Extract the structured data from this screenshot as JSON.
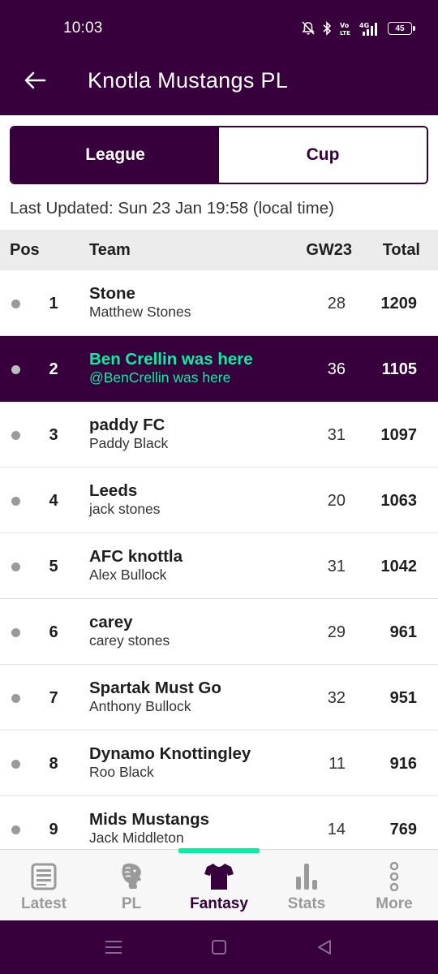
{
  "status_bar": {
    "time": "10:03",
    "battery": "45"
  },
  "header": {
    "title": "Knotla Mustangs PL",
    "back_icon": "arrow-left-icon"
  },
  "tabs": [
    {
      "label": "League",
      "active": true
    },
    {
      "label": "Cup",
      "active": false
    }
  ],
  "last_updated": "Last Updated: Sun 23 Jan 19:58 (local time)",
  "table": {
    "headers": {
      "pos": "Pos",
      "team": "Team",
      "gw": "GW23",
      "total": "Total"
    },
    "rows": [
      {
        "pos": "1",
        "team": "Stone",
        "manager": "Matthew Stones",
        "gw": "28",
        "total": "1209",
        "highlight": false
      },
      {
        "pos": "2",
        "team": "Ben Crellin was here",
        "manager": "@BenCrellin was here",
        "gw": "36",
        "total": "1105",
        "highlight": true
      },
      {
        "pos": "3",
        "team": "paddy FC",
        "manager": "Paddy Black",
        "gw": "31",
        "total": "1097",
        "highlight": false
      },
      {
        "pos": "4",
        "team": "Leeds",
        "manager": "jack stones",
        "gw": "20",
        "total": "1063",
        "highlight": false
      },
      {
        "pos": "5",
        "team": "AFC knottla",
        "manager": "Alex Bullock",
        "gw": "31",
        "total": "1042",
        "highlight": false
      },
      {
        "pos": "6",
        "team": "carey",
        "manager": "carey stones",
        "gw": "29",
        "total": "961",
        "highlight": false
      },
      {
        "pos": "7",
        "team": "Spartak Must Go",
        "manager": "Anthony Bullock",
        "gw": "32",
        "total": "951",
        "highlight": false
      },
      {
        "pos": "8",
        "team": "Dynamo Knottingley",
        "manager": "Roo Black",
        "gw": "11",
        "total": "916",
        "highlight": false
      },
      {
        "pos": "9",
        "team": "Mids Mustangs",
        "manager": "Jack Middleton",
        "gw": "14",
        "total": "769",
        "highlight": false
      }
    ]
  },
  "bottom_nav": [
    {
      "label": "Latest",
      "icon": "news-icon",
      "active": false
    },
    {
      "label": "PL",
      "icon": "lion-icon",
      "active": false
    },
    {
      "label": "Fantasy",
      "icon": "shirt-icon",
      "active": true
    },
    {
      "label": "Stats",
      "icon": "bar-chart-icon",
      "active": false
    },
    {
      "label": "More",
      "icon": "more-vertical-icon",
      "active": false
    }
  ],
  "colors": {
    "primary": "#37003c",
    "accent": "#05f0a5",
    "inactive": "#9a9a9a"
  }
}
